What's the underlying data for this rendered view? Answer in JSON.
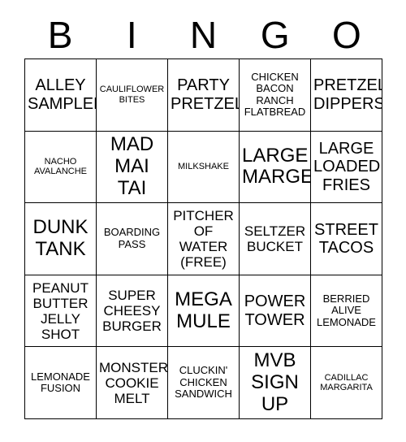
{
  "card": {
    "title": "BINGO",
    "header_letters": [
      "B",
      "I",
      "N",
      "G",
      "O"
    ],
    "columns": 5,
    "rows": 5,
    "colors": {
      "background": "#ffffff",
      "border": "#000000",
      "text": "#000000"
    },
    "cells": [
      {
        "text": "ALLEY\nSAMPLER",
        "size": "lg"
      },
      {
        "text": "CAULIFLOWER\nBITES",
        "size": "xs"
      },
      {
        "text": "PARTY\nPRETZEL",
        "size": "lg"
      },
      {
        "text": "CHICKEN\nBACON\nRANCH\nFLATBREAD",
        "size": "sm"
      },
      {
        "text": "PRETZEL\nDIPPERS",
        "size": "lg"
      },
      {
        "text": "NACHO\nAVALANCHE",
        "size": "xs"
      },
      {
        "text": "MAD\nMAI\nTAI",
        "size": "xl"
      },
      {
        "text": "MILKSHAKE",
        "size": "xs"
      },
      {
        "text": "LARGE\nMARGE",
        "size": "xl"
      },
      {
        "text": "LARGE\nLOADED\nFRIES",
        "size": "lg"
      },
      {
        "text": "DUNK\nTANK",
        "size": "xl"
      },
      {
        "text": "BOARDING\nPASS",
        "size": "sm"
      },
      {
        "text": "PITCHER\nOF\nWATER\n(FREE)",
        "size": "md"
      },
      {
        "text": "SELTZER\nBUCKET",
        "size": "md"
      },
      {
        "text": "STREET\nTACOS",
        "size": "lg"
      },
      {
        "text": "PEANUT\nBUTTER\nJELLY\nSHOT",
        "size": "md"
      },
      {
        "text": "SUPER\nCHEESY\nBURGER",
        "size": "md"
      },
      {
        "text": "MEGA\nMULE",
        "size": "xl"
      },
      {
        "text": "POWER\nTOWER",
        "size": "lg"
      },
      {
        "text": "BERRIED\nALIVE\nLEMONADE",
        "size": "sm"
      },
      {
        "text": "LEMONADE\nFUSION",
        "size": "sm"
      },
      {
        "text": "MONSTER\nCOOKIE\nMELT",
        "size": "md"
      },
      {
        "text": "CLUCKIN'\nCHICKEN\nSANDWICH",
        "size": "sm"
      },
      {
        "text": "MVB\nSIGN\nUP",
        "size": "xl"
      },
      {
        "text": "CADILLAC\nMARGARITA",
        "size": "xs"
      }
    ]
  }
}
